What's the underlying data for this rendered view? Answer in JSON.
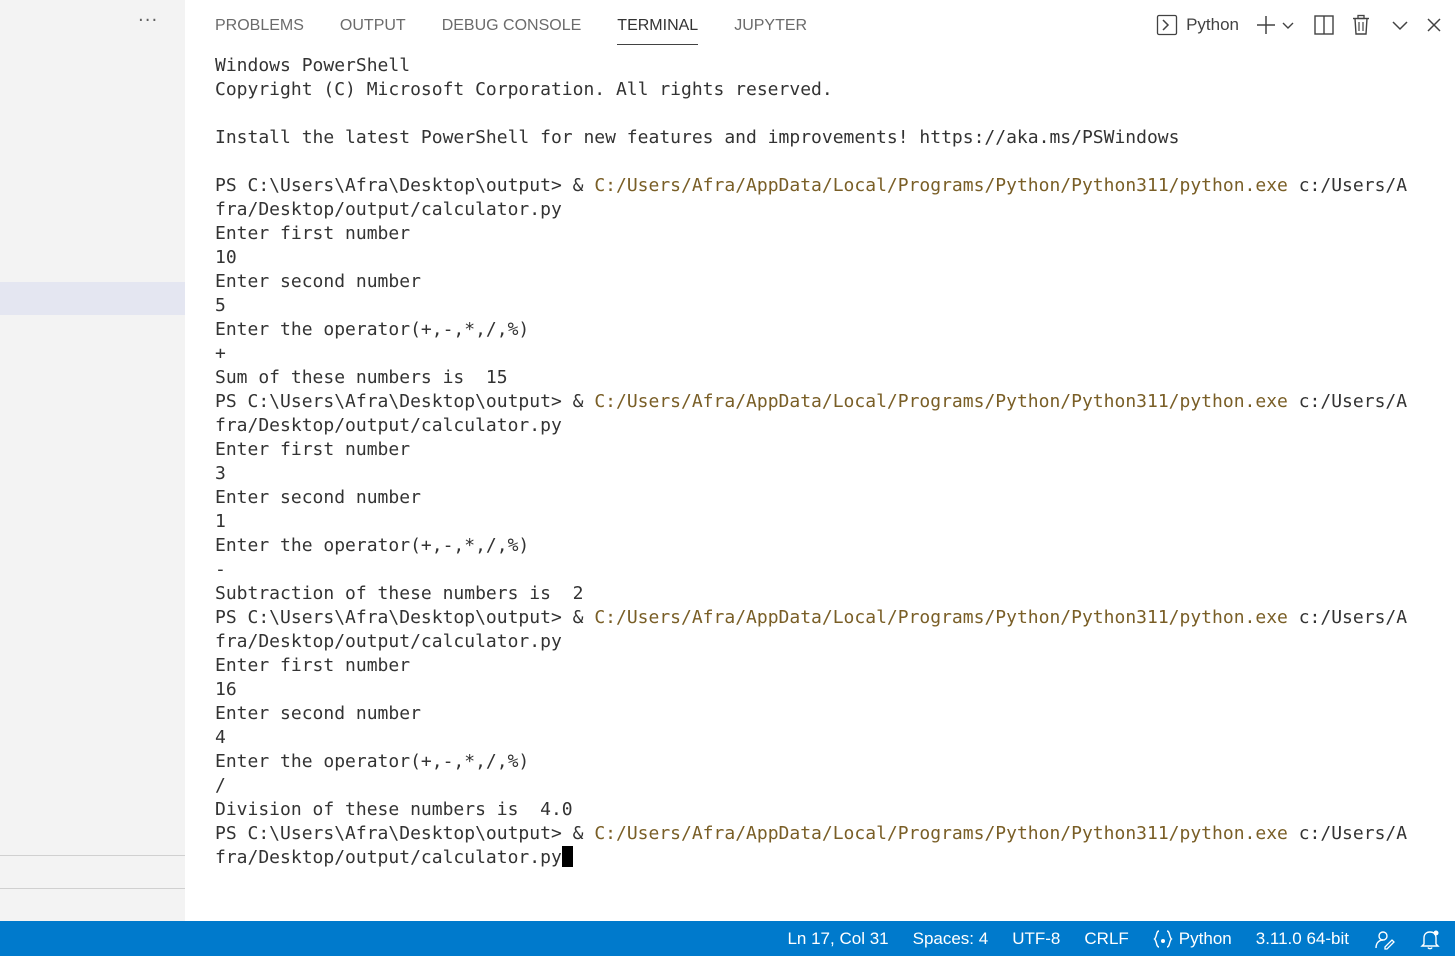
{
  "sidebar": {
    "more_label": "···"
  },
  "panel": {
    "tabs": [
      {
        "label": "PROBLEMS"
      },
      {
        "label": "OUTPUT"
      },
      {
        "label": "DEBUG CONSOLE"
      },
      {
        "label": "TERMINAL",
        "active": true
      },
      {
        "label": "JUPYTER"
      }
    ],
    "shell_label": "Python"
  },
  "terminal": {
    "header": [
      "Windows PowerShell",
      "Copyright (C) Microsoft Corporation. All rights reserved.",
      "",
      "Install the latest PowerShell for new features and improvements! https://aka.ms/PSWindows",
      ""
    ],
    "prompt": "PS C:\\Users\\Afra\\Desktop\\output> ",
    "amp": "& ",
    "python_path": "C:/Users/Afra/AppData/Local/Programs/Python/Python311/python.exe",
    "script_arg_start": " c:/Users/A",
    "script_arg_end": "fra/Desktop/output/calculator.py",
    "runs": [
      {
        "lines": [
          "Enter first number",
          "10",
          "Enter second number",
          "5",
          "Enter the operator(+,-,*,/,%)",
          "+",
          "Sum of these numbers is  15"
        ]
      },
      {
        "lines": [
          "Enter first number",
          "3",
          "Enter second number",
          "1",
          "Enter the operator(+,-,*,/,%)",
          "-",
          "Subtraction of these numbers is  2"
        ]
      },
      {
        "lines": [
          "Enter first number",
          "16",
          "Enter second number",
          "4",
          "Enter the operator(+,-,*,/,%)",
          "/",
          "Division of these numbers is  4.0"
        ]
      }
    ]
  },
  "statusbar": {
    "position": "Ln 17, Col 31",
    "spaces": "Spaces: 4",
    "encoding": "UTF-8",
    "eol": "CRLF",
    "language": "Python",
    "interpreter": "3.11.0 64-bit"
  },
  "colors": {
    "statusbar_bg": "#007acc",
    "path_text": "#795e26",
    "terminal_text": "#333333"
  },
  "icons": {
    "terminal_shell": "terminal-icon",
    "new_terminal": "plus-icon",
    "dropdown": "chevron-down-icon",
    "split": "split-icon",
    "kill": "trash-icon",
    "maximize": "chevron-up-down-icon",
    "close": "close-icon",
    "language": "braces-icon",
    "feedback": "feedback-icon",
    "notifications": "bell-icon"
  }
}
